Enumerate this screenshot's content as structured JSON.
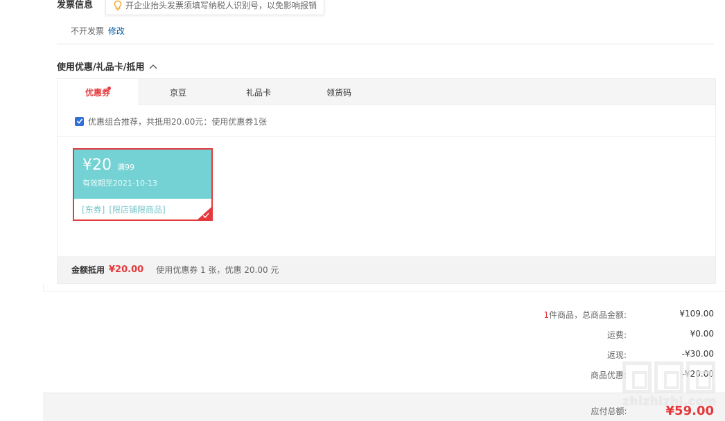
{
  "invoice": {
    "title": "发票信息",
    "tip": "开企业抬头发票须填写纳税人识别号，以免影响报销",
    "status": "不开发票",
    "modify_link": "修改"
  },
  "coupon_section": {
    "title": "使用优惠/礼品卡/抵用",
    "tabs": [
      {
        "label": "优惠券",
        "active": true
      },
      {
        "label": "京豆"
      },
      {
        "label": "礼品卡"
      },
      {
        "label": "领货码"
      }
    ],
    "recommend_text": "优惠组合推荐，共抵用20.00元：使用优惠券1张",
    "coupon": {
      "amount": "¥20",
      "condition": "满99",
      "valid": "有效期至2021-10-13",
      "tag1": "[东券]",
      "tag2": "[限店铺限商品]"
    },
    "summary": {
      "label": "金额抵用",
      "value": "¥20.00",
      "desc": "使用优惠券 1 张，优惠 20.00 元"
    }
  },
  "totals": {
    "count": "1",
    "items_label": "件商品，总商品金额:",
    "items_amount": "¥109.00",
    "shipping_label": "运费:",
    "shipping_amount": "¥0.00",
    "rebate_label": "返现:",
    "rebate_amount": "-¥30.00",
    "discount_label": "商品优惠:",
    "discount_amount": "-¥20.00",
    "payable_label": "应付总额:",
    "payable_amount": "¥59.00"
  },
  "watermark": {
    "text": "zhizhizhi.com"
  },
  "colors": {
    "accent_red": "#e4393c",
    "coupon_teal": "#74d2d4",
    "link_blue": "#005aa0"
  }
}
